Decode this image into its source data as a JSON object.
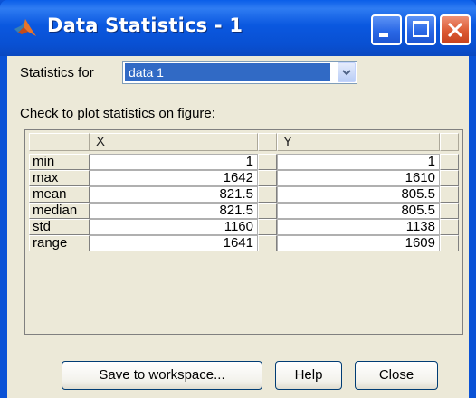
{
  "window": {
    "title": "Data Statistics - 1"
  },
  "stats": {
    "label": "Statistics for",
    "selected": "data 1"
  },
  "check_label": "Check to plot statistics on figure:",
  "table": {
    "columns": [
      "X",
      "Y"
    ],
    "rows": [
      {
        "label": "min",
        "x": "1",
        "y": "1"
      },
      {
        "label": "max",
        "x": "1642",
        "y": "1610"
      },
      {
        "label": "mean",
        "x": "821.5",
        "y": "805.5"
      },
      {
        "label": "median",
        "x": "821.5",
        "y": "805.5"
      },
      {
        "label": "std",
        "x": "1160",
        "y": "1138"
      },
      {
        "label": "range",
        "x": "1641",
        "y": "1609"
      }
    ]
  },
  "buttons": {
    "save": "Save to workspace...",
    "help": "Help",
    "close": "Close"
  },
  "colors": {
    "title_bar": "#0a58e0",
    "selection": "#316ac5",
    "close_button": "#dc5a33",
    "dialog_face": "#ece9d8"
  }
}
